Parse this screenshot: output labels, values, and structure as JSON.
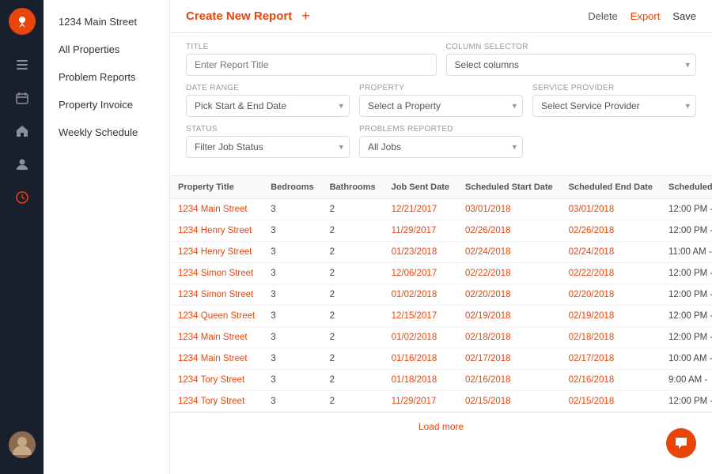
{
  "sidebar": {
    "logo_alt": "App Logo",
    "icons": [
      {
        "name": "checkbox-icon",
        "symbol": "☑",
        "active": false
      },
      {
        "name": "calendar-icon",
        "symbol": "📅",
        "active": false
      },
      {
        "name": "home-icon",
        "symbol": "⌂",
        "active": false
      },
      {
        "name": "person-icon",
        "symbol": "👤",
        "active": false
      },
      {
        "name": "clock-icon",
        "symbol": "⏱",
        "active": true
      }
    ],
    "avatar_initial": "👤"
  },
  "nav": {
    "items": [
      {
        "label": "1234 Main Street",
        "active": false
      },
      {
        "label": "All Properties",
        "active": false
      },
      {
        "label": "Problem Reports",
        "active": false
      },
      {
        "label": "Property Invoice",
        "active": false
      },
      {
        "label": "Weekly Schedule",
        "active": false
      }
    ]
  },
  "header": {
    "title": "Create New Report",
    "add_label": "+",
    "delete_label": "Delete",
    "export_label": "Export",
    "save_label": "Save"
  },
  "form": {
    "title_label": "Title",
    "title_placeholder": "Enter Report Title",
    "column_selector_label": "Column Selector",
    "column_selector_placeholder": "Select columns",
    "date_range_label": "Date Range",
    "date_range_value": "Pick Start & End Date",
    "property_label": "Property",
    "property_value": "Select a Property",
    "service_provider_label": "Service Provider",
    "service_provider_value": "Select Service Provider",
    "status_label": "Status",
    "status_value": "Filter Job Status",
    "problems_reported_label": "Problems Reported",
    "problems_reported_value": "All Jobs"
  },
  "table": {
    "columns": [
      "Property Title",
      "Bedrooms",
      "Bathrooms",
      "Job Sent Date",
      "Scheduled Start Date",
      "Scheduled End Date",
      "Scheduled"
    ],
    "rows": [
      {
        "property": "1234 Main Street",
        "bedrooms": "3",
        "bathrooms": "2",
        "job_sent": "12/21/2017",
        "sched_start": "03/01/2018",
        "sched_end": "03/01/2018",
        "scheduled": "12:00 PM -"
      },
      {
        "property": "1234 Henry Street",
        "bedrooms": "3",
        "bathrooms": "2",
        "job_sent": "11/29/2017",
        "sched_start": "02/26/2018",
        "sched_end": "02/26/2018",
        "scheduled": "12:00 PM -"
      },
      {
        "property": "1234 Henry Street",
        "bedrooms": "3",
        "bathrooms": "2",
        "job_sent": "01/23/2018",
        "sched_start": "02/24/2018",
        "sched_end": "02/24/2018",
        "scheduled": "11:00 AM -"
      },
      {
        "property": "1234 Simon Street",
        "bedrooms": "3",
        "bathrooms": "2",
        "job_sent": "12/06/2017",
        "sched_start": "02/22/2018",
        "sched_end": "02/22/2018",
        "scheduled": "12:00 PM -"
      },
      {
        "property": "1234 Simon Street",
        "bedrooms": "3",
        "bathrooms": "2",
        "job_sent": "01/02/2018",
        "sched_start": "02/20/2018",
        "sched_end": "02/20/2018",
        "scheduled": "12:00 PM -"
      },
      {
        "property": "1234 Queen Street",
        "bedrooms": "3",
        "bathrooms": "2",
        "job_sent": "12/15/2017",
        "sched_start": "02/19/2018",
        "sched_end": "02/19/2018",
        "scheduled": "12:00 PM -"
      },
      {
        "property": "1234 Main Street",
        "bedrooms": "3",
        "bathrooms": "2",
        "job_sent": "01/02/2018",
        "sched_start": "02/18/2018",
        "sched_end": "02/18/2018",
        "scheduled": "12:00 PM -"
      },
      {
        "property": "1234 Main Street",
        "bedrooms": "3",
        "bathrooms": "2",
        "job_sent": "01/16/2018",
        "sched_start": "02/17/2018",
        "sched_end": "02/17/2018",
        "scheduled": "10:00 AM -"
      },
      {
        "property": "1234 Tory Street",
        "bedrooms": "3",
        "bathrooms": "2",
        "job_sent": "01/18/2018",
        "sched_start": "02/16/2018",
        "sched_end": "02/16/2018",
        "scheduled": "9:00 AM -"
      },
      {
        "property": "1234 Tory Street",
        "bedrooms": "3",
        "bathrooms": "2",
        "job_sent": "11/29/2017",
        "sched_start": "02/15/2018",
        "sched_end": "02/15/2018",
        "scheduled": "12:00 PM -"
      }
    ],
    "load_more_label": "Load more"
  }
}
